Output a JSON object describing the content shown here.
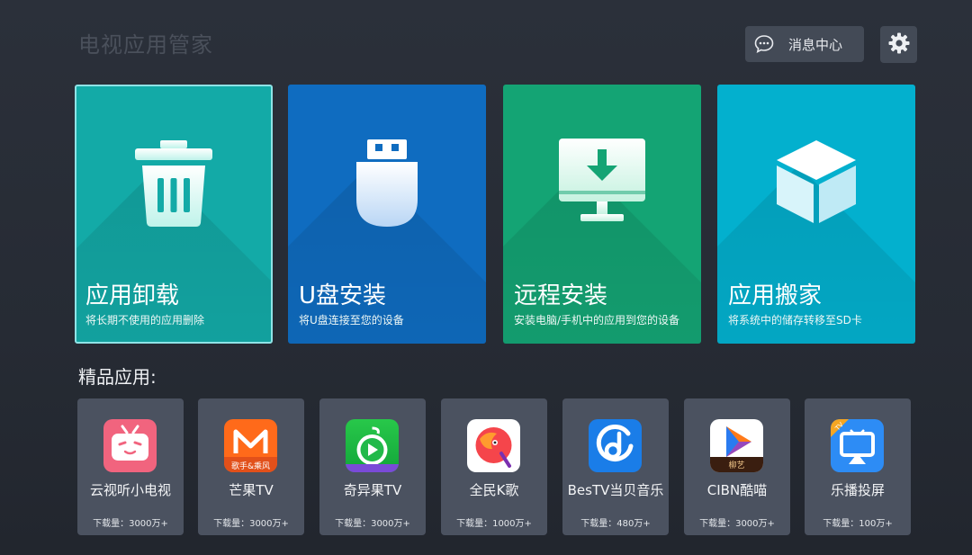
{
  "header": {
    "title": "电视应用管家",
    "message_button_label": "消息中心",
    "message_icon": "chat-bubble-icon",
    "settings_icon": "gear-icon"
  },
  "feature_tiles": [
    {
      "title": "应用卸载",
      "subtitle": "将长期不使用的应用删除",
      "icon": "trash-icon",
      "color": "#13aaa7",
      "selected": true
    },
    {
      "title": "U盘安装",
      "subtitle": "将U盘连接至您的设备",
      "icon": "usb-drive-icon",
      "color": "#0f6cc0"
    },
    {
      "title": "远程安装",
      "subtitle": "安装电脑/手机中的应用到您的设备",
      "icon": "monitor-download-icon",
      "color": "#14a474"
    },
    {
      "title": "应用搬家",
      "subtitle": "将系统中的储存转移至SD卡",
      "icon": "cube-icon",
      "color": "#03b0ce"
    }
  ],
  "featured": {
    "section_title": "精品应用:",
    "apps": [
      {
        "name": "云视听小电视",
        "downloads": "下载量：3000万+",
        "icon": "bilibili-tv-icon"
      },
      {
        "name": "芒果TV",
        "downloads": "下载量：3000万+",
        "icon": "mango-tv-icon",
        "icon_caption": "歌手&乘风"
      },
      {
        "name": "奇异果TV",
        "downloads": "下载量：3000万+",
        "icon": "kiwi-tv-icon"
      },
      {
        "name": "全民K歌",
        "downloads": "下载量：1000万+",
        "icon": "karaoke-icon"
      },
      {
        "name": "BesTV当贝音乐",
        "downloads": "下载量：480万+",
        "icon": "music-note-icon"
      },
      {
        "name": "CIBN酷喵",
        "downloads": "下载量：3000万+",
        "icon": "cibn-play-icon",
        "icon_caption": "柳艺"
      },
      {
        "name": "乐播投屏",
        "downloads": "下载量：100万+",
        "icon": "screen-cast-icon",
        "icon_caption": "TV"
      }
    ]
  }
}
